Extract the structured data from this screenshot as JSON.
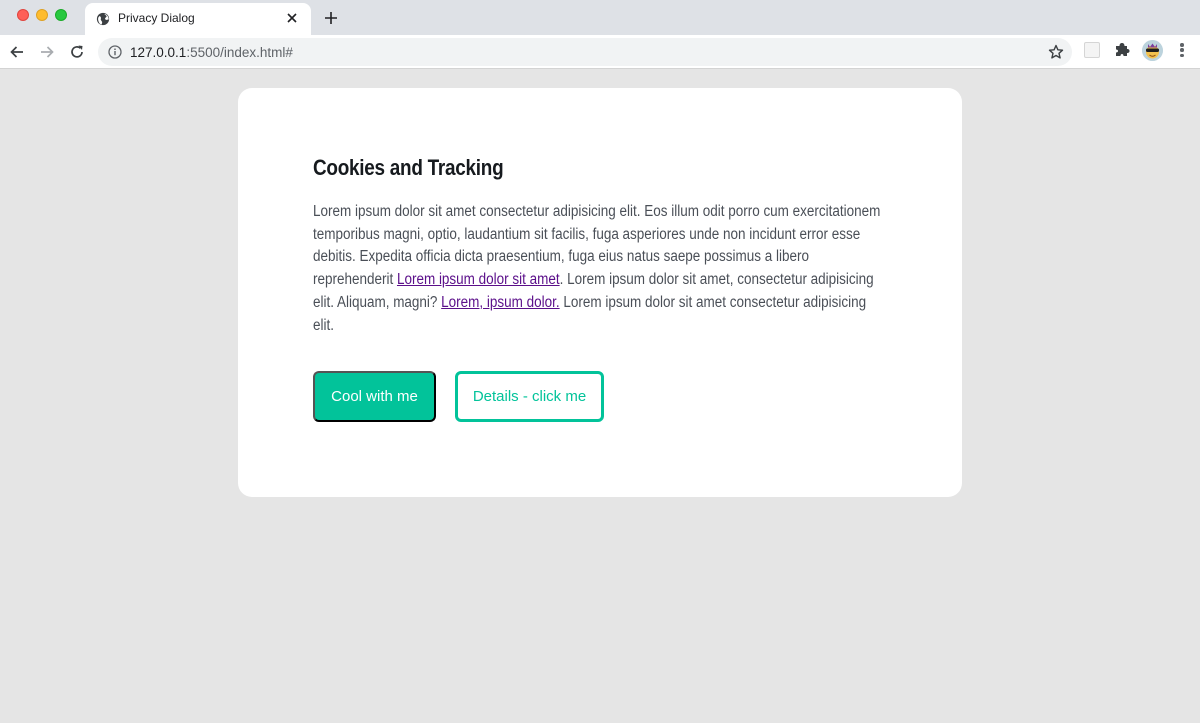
{
  "browser": {
    "tab": {
      "title": "Privacy Dialog",
      "favicon": "globe-icon"
    },
    "url": {
      "host": "127.0.0.1",
      "rest": ":5500/index.html#"
    },
    "icons": {
      "back": "arrow-left-icon",
      "forward": "arrow-right-icon",
      "reload": "reload-icon",
      "info": "info-icon",
      "bookmark": "star-icon",
      "extensions": "puzzle-icon",
      "menu": "more-vertical-icon"
    }
  },
  "dialog": {
    "title": "Cookies and Tracking",
    "body": {
      "text_1": "Lorem ipsum dolor sit amet consectetur adipisicing elit. Eos illum odit porro cum exercitationem temporibus magni, optio, laudantium sit facilis, fuga asperiores unde non incidunt error esse debitis. Expedita officia dicta praesentium, fuga eius natus saepe possimus a libero reprehenderit ",
      "link_1": "Lorem ipsum dolor sit amet",
      "text_2": ". Lorem ipsum dolor sit amet, consectetur adipisicing elit. Aliquam, magni? ",
      "link_2": "Lorem, ipsum dolor.",
      "text_3": " Lorem ipsum dolor sit amet consectetur adipisicing elit."
    },
    "buttons": {
      "accept_label": "Cool with me",
      "details_label": "Details - click me"
    }
  },
  "colors": {
    "accent": "#02c39a",
    "link": "#5b0f8a",
    "page_background": "#e5e5e5"
  }
}
